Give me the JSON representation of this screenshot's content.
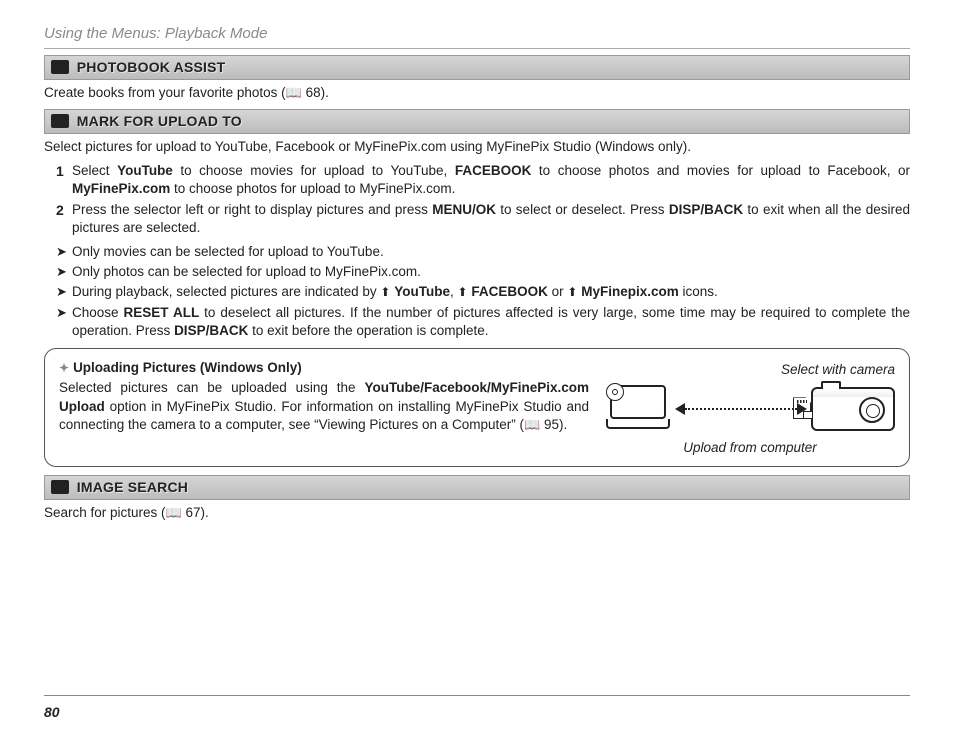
{
  "header": {
    "breadcrumb": "Using the Menus: Playback Mode"
  },
  "page_number": "80",
  "sections": [
    {
      "icon": "photobook-icon",
      "title": "PHOTOBOOK ASSIST",
      "body_pre": "Create books from your favorite photos (",
      "page_ref": "68",
      "body_post": ")."
    },
    {
      "icon": "upload-icon",
      "title": "MARK FOR UPLOAD TO",
      "body": "Select pictures for upload to YouTube, Facebook or MyFinePix.com using MyFinePix Studio (Windows only).",
      "steps": [
        {
          "num": "1",
          "parts": [
            "Select ",
            "YouTube",
            " to choose movies for upload to YouTube, ",
            "FACEBOOK",
            " to choose photos and movies for upload to Facebook, or ",
            "MyFinePix.com",
            " to choose photos for upload to MyFinePix.com."
          ]
        },
        {
          "num": "2",
          "parts": [
            "Press the selector left or right to display pictures and press ",
            "MENU/OK",
            " to select or deselect.  Press ",
            "DISP/BACK",
            " to exit when all the desired pictures are selected."
          ]
        }
      ],
      "bullets": [
        {
          "parts": [
            "Only movies can be selected for upload to YouTube."
          ]
        },
        {
          "parts": [
            "Only photos can be selected for upload to MyFinePix.com."
          ]
        },
        {
          "parts": [
            "During playback, selected pictures are indicated by ",
            "ICON",
            " ",
            "YouTube",
            ", ",
            "ICON",
            " ",
            "FACEBOOK",
            " or ",
            "ICON",
            " ",
            "MyFinepix.com",
            " icons."
          ]
        },
        {
          "parts": [
            "Choose ",
            "RESET ALL",
            " to deselect all pictures.  If the number of pictures affected is very large, some time may be required to complete the operation.  Press ",
            "DISP/BACK",
            " to exit before the operation is complete."
          ]
        }
      ],
      "note": {
        "title": "Uploading Pictures (Windows Only)",
        "body_parts": [
          "Selected pictures can be uploaded using the ",
          "YouTube/Facebook/MyFinePix.com Upload",
          " option in MyFinePix Studio.  For information on installing MyFinePix Studio and connecting the camera to a computer, see “Viewing Pictures on a Computer” (",
          "PAGEREF",
          " 95)."
        ],
        "figure": {
          "top_label": "Select with camera",
          "bottom_label": "Upload from computer"
        }
      }
    },
    {
      "icon": "search-icon",
      "title": "IMAGE SEARCH",
      "body_pre": "Search for pictures (",
      "page_ref": "67",
      "body_post": ")."
    }
  ]
}
